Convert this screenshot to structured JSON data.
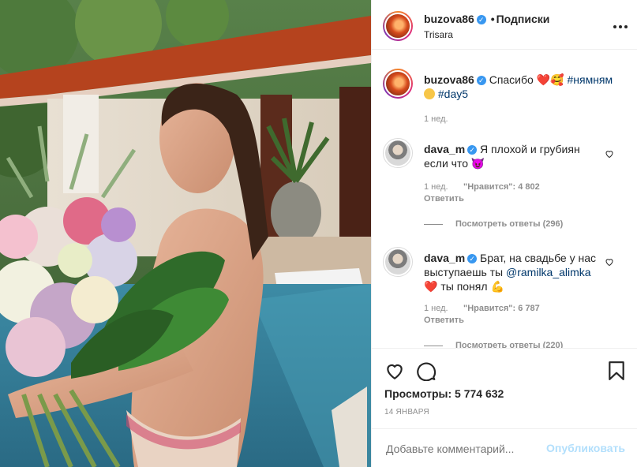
{
  "post": {
    "username": "buzova86",
    "follow_label": "Подписки",
    "location": "Trisara",
    "caption": {
      "text": "Спасибо",
      "emoji": "❤️🥰",
      "hashtag1": "#нямням",
      "hashtag2": "#day5",
      "time": "1 нед."
    }
  },
  "comments": [
    {
      "username": "dava_m",
      "text_line1": "Я плохой и грубиян",
      "text_line2": "если что",
      "emoji": "😈",
      "time": "1 нед.",
      "likes": "\"Нравится\": 4 802",
      "reply": "Ответить",
      "view_replies": "Посмотреть ответы (296)"
    },
    {
      "username": "dava_m",
      "text_line1": "Брат, на свадьбе у нас",
      "text_line2_prefix": "выступаешь ты",
      "mention": "@ramilka_alimka",
      "text_line3": "ты понял",
      "emoji_heart": "❤️",
      "emoji_muscle": "💪",
      "time": "1 нед.",
      "likes": "\"Нравится\": 6 787",
      "reply": "Ответить",
      "view_replies": "Посмотреть ответы (220)"
    }
  ],
  "stats": {
    "views": "Просмотры: 5 774 632",
    "date": "14 ЯНВАРЯ"
  },
  "add_comment": {
    "placeholder": "Добавьте комментарий...",
    "publish": "Опубликовать"
  },
  "icons": {
    "more": "more-icon",
    "like": "heart-icon",
    "comment": "comment-icon",
    "save": "bookmark-icon"
  },
  "colors": {
    "accent": "#3897f0",
    "link": "#00376b",
    "muted": "#8e8e8e",
    "publish_disabled": "#b2dffc"
  }
}
